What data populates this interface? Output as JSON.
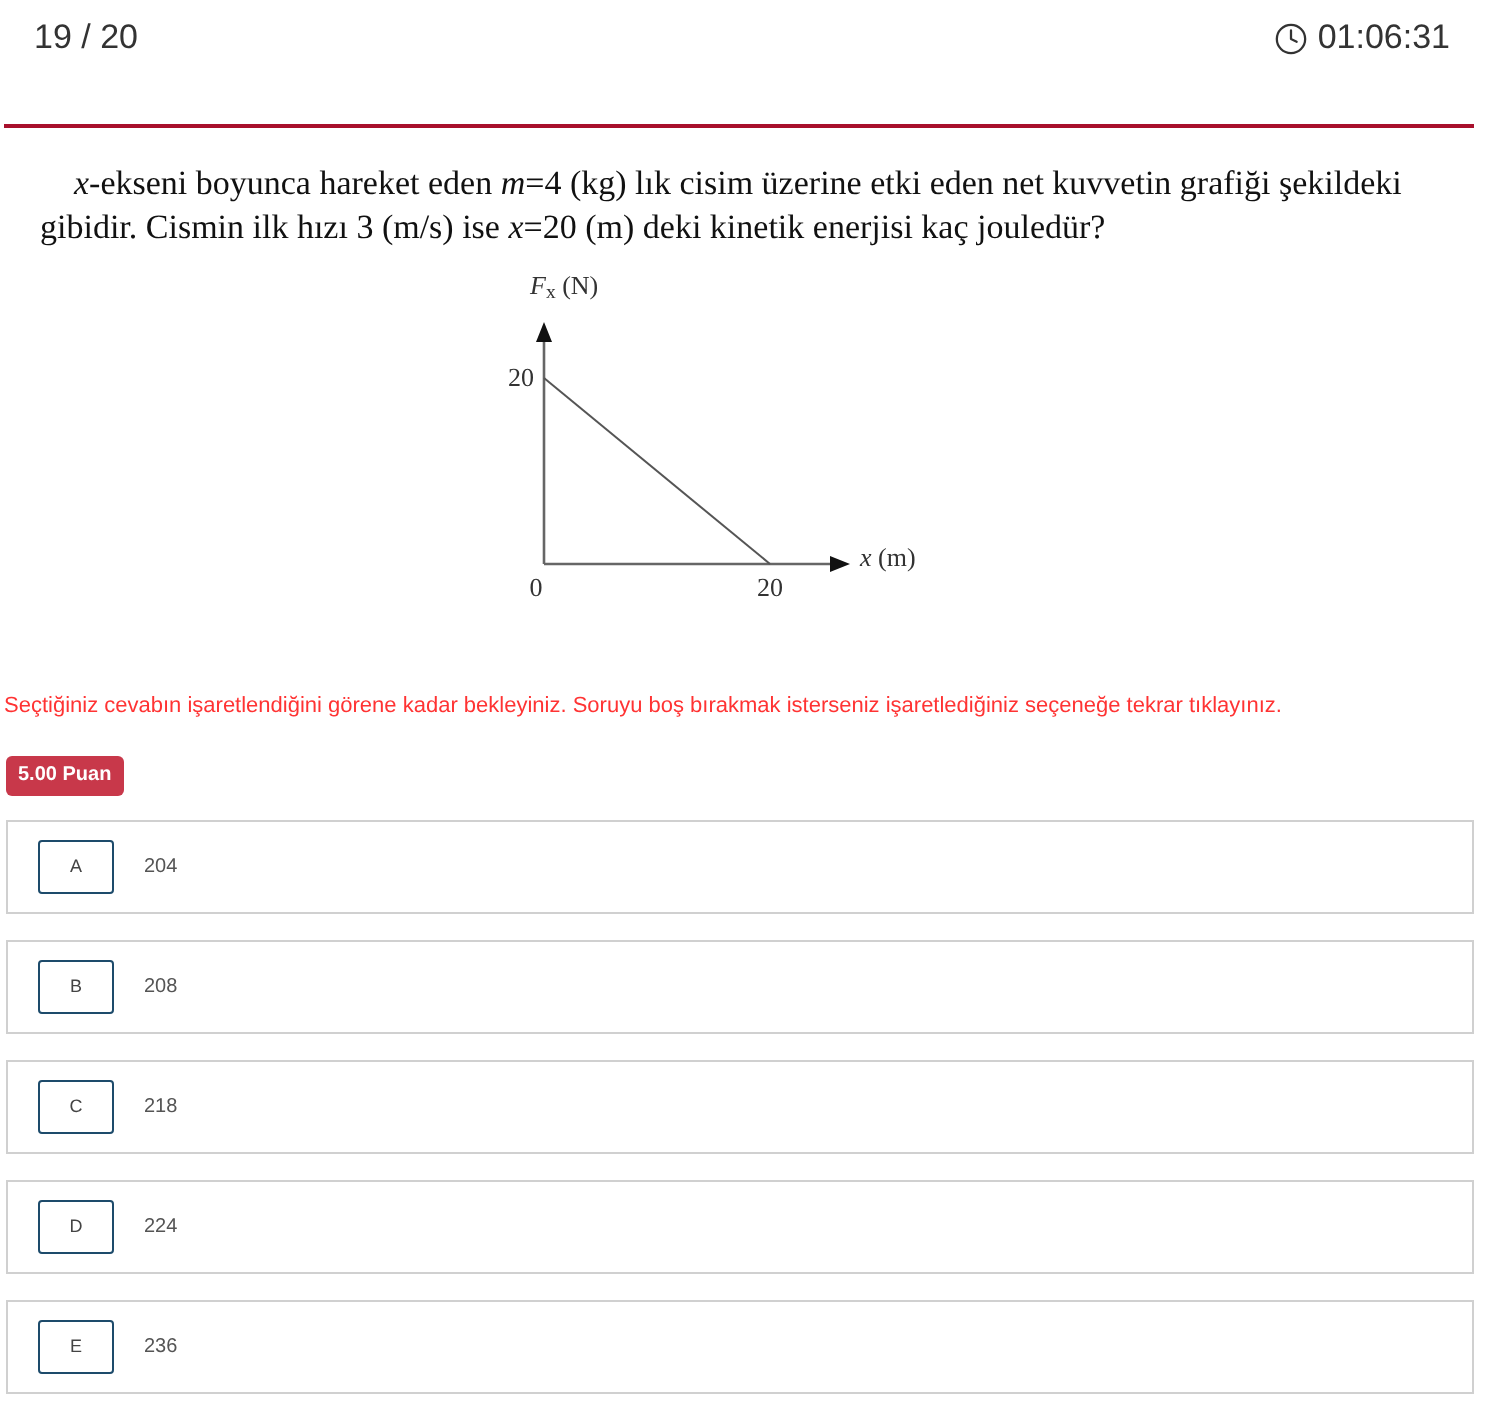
{
  "header": {
    "progress": "19 / 20",
    "timer": "01:06:31"
  },
  "question": {
    "text": "*x*-ekseni boyunca hareket eden *m*=4 (kg) lık cisim üzerine etki eden net kuvvetin grafiği şekildeki gibidir. Cismin ilk hızı 3 (m/s) ise *x*=20 (m) deki kinetik enerjisi kaç jouledür?",
    "figure": {
      "y_axis_title": "*F*$_{x}$ (N)",
      "y_tick": "20",
      "origin": "0",
      "x_tick": "20",
      "x_axis_title": "*x* (m)"
    }
  },
  "notice": "Seçtiğiniz cevabın işaretlendiğini görene kadar bekleyiniz. Soruyu boş bırakmak isterseniz işaretlediğiniz seçeneğe tekrar tıklayınız.",
  "points_badge": "5.00 Puan",
  "options": [
    {
      "letter": "A",
      "text": "204",
      "selected": false
    },
    {
      "letter": "B",
      "text": "208",
      "selected": false
    },
    {
      "letter": "C",
      "text": "218",
      "selected": false
    },
    {
      "letter": "D",
      "text": "224",
      "selected": false
    },
    {
      "letter": "E",
      "text": "236",
      "selected": false
    }
  ]
}
